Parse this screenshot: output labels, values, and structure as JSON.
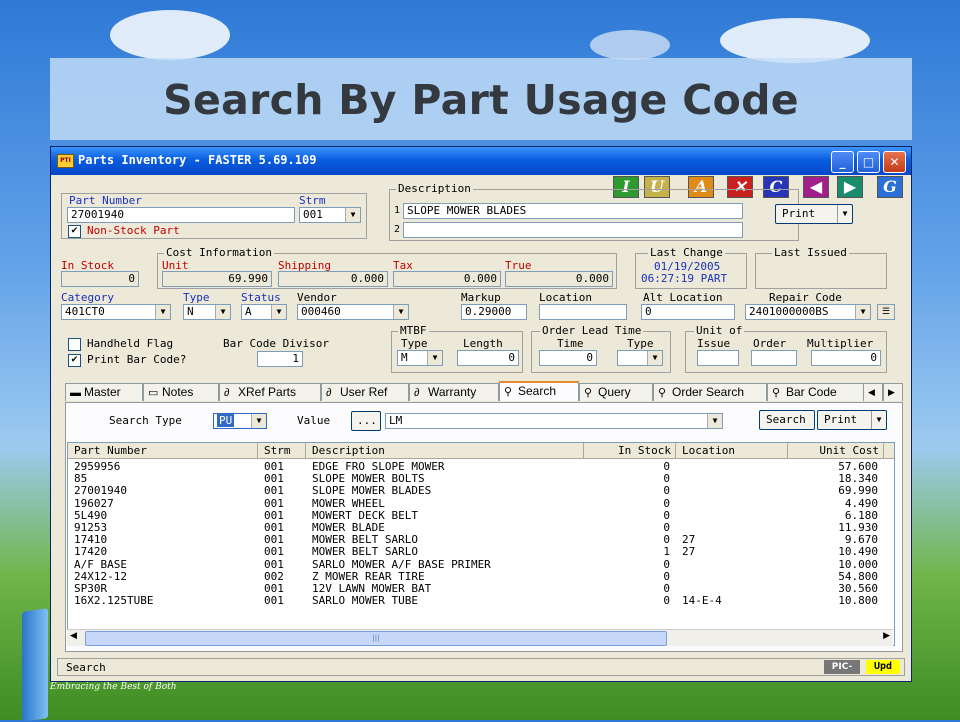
{
  "slide": {
    "title": "Search By Part Usage Code",
    "corner_caption": "Embracing the Best of Both"
  },
  "window": {
    "title": "Parts Inventory - FASTER 5.69.109",
    "app_icon_text": "PTI",
    "minimize": "_",
    "maximize": "□",
    "close": "✕"
  },
  "toolbar": [
    {
      "letter": "I",
      "color": "#2f9a2f",
      "icon": "insert-icon"
    },
    {
      "letter": "U",
      "color": "#c6b24a",
      "icon": "update-icon"
    },
    {
      "letter": "A",
      "color": "#e08a18",
      "icon": "add-icon"
    },
    {
      "letter": "✕",
      "color": "#c81f1f",
      "icon": "delete-icon"
    },
    {
      "letter": "C",
      "color": "#2634b8",
      "icon": "clear-icon"
    },
    {
      "letter": "◀",
      "color": "#a01f8a",
      "icon": "previous-icon"
    },
    {
      "letter": "▶",
      "color": "#1a8c6e",
      "icon": "next-icon"
    },
    {
      "letter": "G",
      "color": "#2a6fd6",
      "icon": "go-icon"
    }
  ],
  "part": {
    "part_number_label": "Part Number",
    "part_number": "27001940",
    "strm_label": "Strm",
    "strm": "001",
    "non_stock_label": "Non-Stock Part",
    "non_stock_checked": "✔"
  },
  "description": {
    "label": "Description",
    "line1_no": "1",
    "line1": "SLOPE MOWER BLADES",
    "line2_no": "2",
    "line2": "",
    "print_button": "Print"
  },
  "cost": {
    "group_label": "Cost Information",
    "in_stock_label": "In Stock",
    "in_stock": "0",
    "unit_label": "Unit",
    "unit": "69.990",
    "shipping_label": "Shipping",
    "shipping": "0.000",
    "tax_label": "Tax",
    "tax": "0.000",
    "true_label": "True",
    "true_val": "0.000"
  },
  "last_change": {
    "label": "Last Change",
    "date": "01/19/2005",
    "time_part": "06:27:19 PART"
  },
  "last_issued": {
    "label": "Last Issued"
  },
  "row3": {
    "category_label": "Category",
    "category": "401CT0",
    "type_label": "Type",
    "type": "N",
    "status_label": "Status",
    "status": "A",
    "vendor_label": "Vendor",
    "vendor": "000460",
    "markup_label": "Markup",
    "markup": "0.29000",
    "location_label": "Location",
    "location": "",
    "alt_location_label": "Alt Location",
    "alt_location": "0",
    "repair_code_label": "Repair Code",
    "repair_code": "2401000000BS"
  },
  "flags": {
    "handheld_label": "Handheld Flag",
    "handheld_checked": "",
    "print_barcode_label": "Print Bar Code?",
    "print_barcode_checked": "✔",
    "barcode_divisor_label": "Bar Code Divisor",
    "barcode_divisor": "1"
  },
  "mtbf": {
    "label": "MTBF",
    "type_label": "Type",
    "type": "M",
    "length_label": "Length",
    "length": "0"
  },
  "lead_time": {
    "label": "Order Lead Time",
    "time_label": "Time",
    "time": "0",
    "type_label": "Type",
    "type": ""
  },
  "unit_of": {
    "label": "Unit of",
    "issue_label": "Issue",
    "issue": "",
    "order_label": "Order",
    "order": "",
    "multiplier_label": "Multiplier",
    "multiplier": "0"
  },
  "tabs": [
    {
      "label": "Master",
      "icon": "folder-icon",
      "glyph": "▬"
    },
    {
      "label": "Notes",
      "icon": "notes-icon",
      "glyph": "▭"
    },
    {
      "label": "XRef Parts",
      "icon": "paperclip-icon",
      "glyph": "∂"
    },
    {
      "label": "User Ref",
      "icon": "paperclip-icon",
      "glyph": "∂"
    },
    {
      "label": "Warranty",
      "icon": "paperclip-icon",
      "glyph": "∂"
    },
    {
      "label": "Search",
      "icon": "magnifier-icon",
      "glyph": "⚲"
    },
    {
      "label": "Query",
      "icon": "magnifier-icon",
      "glyph": "⚲"
    },
    {
      "label": "Order Search",
      "icon": "magnifier-icon",
      "glyph": "⚲"
    },
    {
      "label": "Bar Code",
      "icon": "magnifier-icon",
      "glyph": "⚲"
    }
  ],
  "search": {
    "search_type_label": "Search Type",
    "search_type": "PU",
    "value_label": "Value",
    "ellipsis": "...",
    "value": "LM",
    "search_button": "Search",
    "print_button": "Print"
  },
  "grid": {
    "headers": [
      "Part Number",
      "Strm",
      "Description",
      "In Stock",
      "Location",
      "Unit Cost"
    ],
    "rows": [
      [
        "2959956",
        "001",
        "EDGE FRO SLOPE MOWER",
        "0",
        "",
        "57.600"
      ],
      [
        "85",
        "001",
        "SLOPE MOWER BOLTS",
        "0",
        "",
        "18.340"
      ],
      [
        "27001940",
        "001",
        "SLOPE MOWER BLADES",
        "0",
        "",
        "69.990"
      ],
      [
        "196027",
        "001",
        "MOWER WHEEL",
        "0",
        "",
        "4.490"
      ],
      [
        "5L490",
        "001",
        "MOWERT DECK BELT",
        "0",
        "",
        "6.180"
      ],
      [
        "91253",
        "001",
        "MOWER BLADE",
        "0",
        "",
        "11.930"
      ],
      [
        "17410",
        "001",
        "MOWER BELT SARLO",
        "0",
        "27",
        "9.670"
      ],
      [
        "17420",
        "001",
        "MOWER BELT SARLO",
        "1",
        "27",
        "10.490"
      ],
      [
        "A/F BASE",
        "001",
        "SARLO MOWER A/F BASE PRIMER",
        "0",
        "",
        "10.000"
      ],
      [
        "24X12-12",
        "002",
        "Z MOWER REAR TIRE",
        "0",
        "",
        "54.800"
      ],
      [
        "SP30R",
        "001",
        "12V LAWN MOWER BAT",
        "0",
        "",
        "30.560"
      ],
      [
        "16X2.125TUBE",
        "001",
        "SARLO MOWER TUBE",
        "0",
        "14-E-4",
        "10.800"
      ]
    ]
  },
  "statusbar": {
    "text": "Search",
    "pic_label": "PIC-",
    "upd_label": "Upd"
  }
}
